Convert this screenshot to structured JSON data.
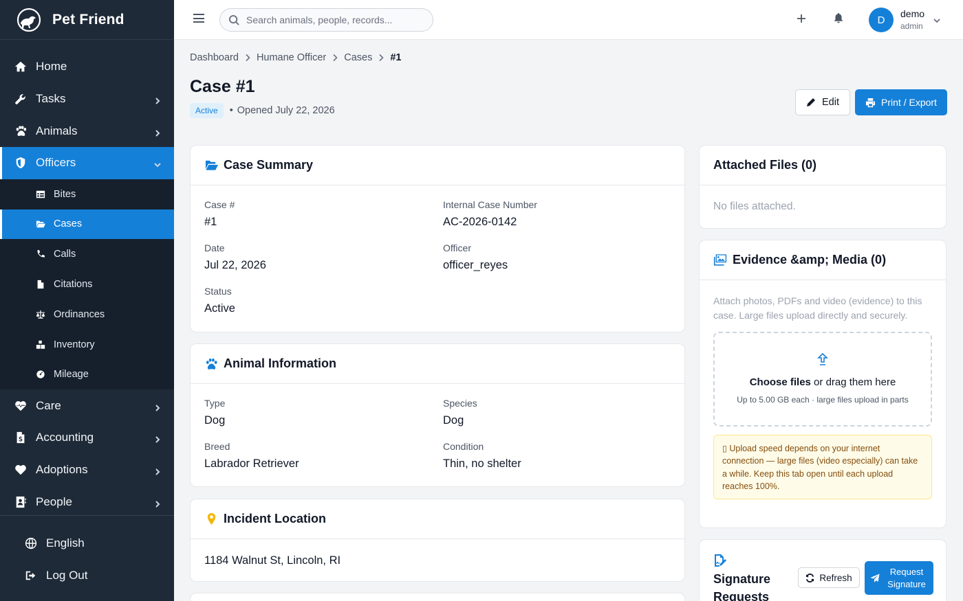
{
  "brand": {
    "name": "Pet Friend"
  },
  "sidebar": {
    "items": [
      {
        "label": "Home",
        "icon": "home-icon"
      },
      {
        "label": "Tasks",
        "icon": "wrench-icon"
      },
      {
        "label": "Animals",
        "icon": "paw-icon"
      },
      {
        "label": "Officers",
        "icon": "shield-icon"
      },
      {
        "label": "Care",
        "icon": "heart-pulse-icon"
      },
      {
        "label": "Accounting",
        "icon": "invoice-icon"
      },
      {
        "label": "Adoptions",
        "icon": "heart-icon"
      },
      {
        "label": "People",
        "icon": "contact-book-icon"
      }
    ],
    "officers_sub": [
      {
        "label": "Bites",
        "icon": "table-icon"
      },
      {
        "label": "Cases",
        "icon": "folder-open-icon"
      },
      {
        "label": "Calls",
        "icon": "phone-icon"
      },
      {
        "label": "Citations",
        "icon": "file-icon"
      },
      {
        "label": "Ordinances",
        "icon": "scale-icon"
      },
      {
        "label": "Inventory",
        "icon": "boxes-icon"
      },
      {
        "label": "Mileage",
        "icon": "gauge-icon"
      }
    ],
    "footer": [
      {
        "label": "English",
        "icon": "globe-icon"
      },
      {
        "label": "Log Out",
        "icon": "logout-icon"
      }
    ]
  },
  "topbar": {
    "search_placeholder": "Search animals, people, records...",
    "avatar_initial": "D",
    "user_name": "demo",
    "user_role": "admin"
  },
  "breadcrumb": [
    "Dashboard",
    "Humane Officer",
    "Cases",
    "#1"
  ],
  "page": {
    "title": "Case #1",
    "status_badge": "Active",
    "dot": "•",
    "opened": "Opened July 22, 2026",
    "edit_label": "Edit",
    "print_label": "Print / Export"
  },
  "case_summary": {
    "title": "Case Summary",
    "fields": [
      {
        "label": "Case #",
        "value": "#1"
      },
      {
        "label": "Internal Case Number",
        "value": "AC-2026-0142"
      },
      {
        "label": "Date",
        "value": "Jul 22, 2026"
      },
      {
        "label": "Officer",
        "value": "officer_reyes"
      },
      {
        "label": "Status",
        "value": "Active"
      }
    ]
  },
  "animal_info": {
    "title": "Animal Information",
    "fields": [
      {
        "label": "Type",
        "value": "Dog"
      },
      {
        "label": "Species",
        "value": "Dog"
      },
      {
        "label": "Breed",
        "value": "Labrador Retriever"
      },
      {
        "label": "Condition",
        "value": "Thin, no shelter"
      }
    ]
  },
  "incident_location": {
    "title": "Incident Location",
    "address": "1184 Walnut St, Lincoln, RI"
  },
  "attached_files": {
    "title": "Attached Files (0)",
    "empty": "No files attached."
  },
  "evidence": {
    "title": "Evidence &amp; Media (0)",
    "description": "Attach photos, PDFs and video (evidence) to this case. Large files upload directly and securely.",
    "choose_files": "Choose files",
    "drag_text": " or drag them here",
    "limit": "Up to 5.00 GB each · large files upload in parts",
    "notice": "▯ Upload speed depends on your internet connection — large files (video especially) can take a while. Keep this tab open until each upload reaches 100%."
  },
  "signature": {
    "title": "Signature Requests",
    "refresh_label": "Refresh",
    "request_label": "Request Signature"
  },
  "colors": {
    "primary": "#1580d8",
    "sidebar": "#1f2a38",
    "sidebar_sub": "#16202c"
  }
}
